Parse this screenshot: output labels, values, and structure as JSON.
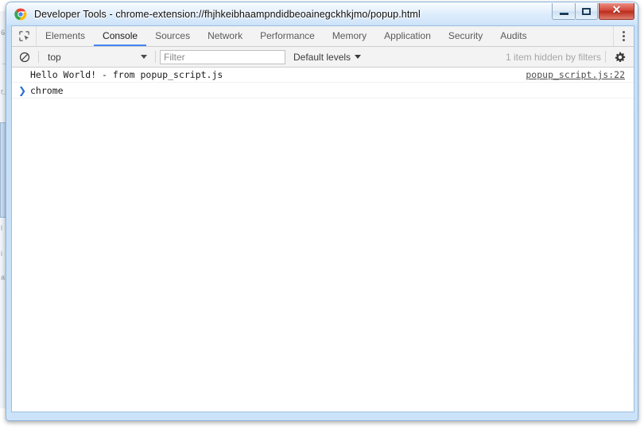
{
  "window": {
    "title": "Developer Tools - chrome-extension://fhjhkeibhaampndidbeoainegckhkjmo/popup.html",
    "logo": "chrome-logo",
    "controls": {
      "minimize_label": "—",
      "maximize_label": "□",
      "close_label": "✕"
    }
  },
  "devtools": {
    "inspect_icon": "inspect-element-icon",
    "tabs": [
      {
        "label": "Elements",
        "active": false
      },
      {
        "label": "Console",
        "active": true
      },
      {
        "label": "Sources",
        "active": false
      },
      {
        "label": "Network",
        "active": false
      },
      {
        "label": "Performance",
        "active": false
      },
      {
        "label": "Memory",
        "active": false
      },
      {
        "label": "Application",
        "active": false
      },
      {
        "label": "Security",
        "active": false
      },
      {
        "label": "Audits",
        "active": false
      }
    ],
    "overflow_icon": "more-vertical-icon",
    "accent_color": "#4285f4"
  },
  "filterbar": {
    "clear_icon": "clear-console-icon",
    "context": "top",
    "filter_placeholder": "Filter",
    "filter_value": "",
    "levels": "Default levels",
    "hidden_notice": "1 item hidden by filters",
    "settings_icon": "gear-icon"
  },
  "console": {
    "messages": [
      {
        "text": "Hello World! - from popup_script.js",
        "source": "popup_script.js:22"
      }
    ],
    "prompt": {
      "arrow": "❯",
      "value": "chrome"
    }
  },
  "background_window": {
    "glyphs": [
      "6",
      "r",
      "l",
      "i",
      "a"
    ]
  }
}
